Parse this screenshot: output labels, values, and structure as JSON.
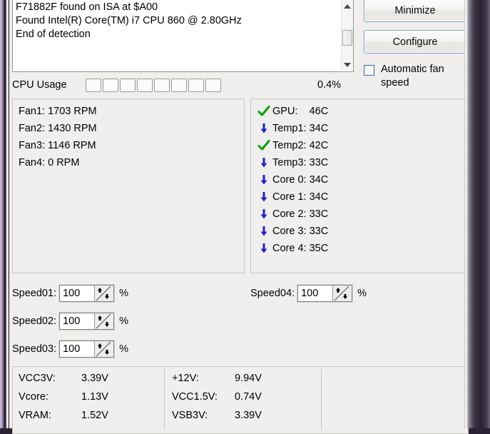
{
  "log": {
    "lines": "F71882F found on ISA at $A00\nFound Intel(R) Core(TM) i7 CPU 860 @ 2.80GHz\nEnd of detection"
  },
  "scrollbar": {
    "up_icon": "scroll-up-arrow",
    "down_icon": "scroll-down-arrow"
  },
  "buttons": {
    "minimize": "Minimize",
    "configure": "Configure"
  },
  "auto_fan": {
    "label": "Automatic fan speed",
    "checked": false
  },
  "cpu_usage": {
    "label": "CPU Usage",
    "percent": "0.4%",
    "blocks_total": 8,
    "blocks_filled": 0
  },
  "fans": [
    {
      "label": "Fan1:",
      "value": "1703 RPM"
    },
    {
      "label": "Fan2:",
      "value": "1430 RPM"
    },
    {
      "label": "Fan3:",
      "value": "1146 RPM"
    },
    {
      "label": "Fan4:",
      "value": "0 RPM"
    }
  ],
  "temps": [
    {
      "icon": "green-check-icon",
      "name": "GPU:",
      "value": "46C"
    },
    {
      "icon": "blue-down-arrow-icon",
      "name": "Temp1:",
      "value": "34C"
    },
    {
      "icon": "green-check-icon",
      "name": "Temp2:",
      "value": "42C"
    },
    {
      "icon": "blue-down-arrow-icon",
      "name": "Temp3:",
      "value": "33C"
    },
    {
      "icon": "blue-down-arrow-icon",
      "name": "Core 0:",
      "value": "34C"
    },
    {
      "icon": "blue-down-arrow-icon",
      "name": "Core 1:",
      "value": "34C"
    },
    {
      "icon": "blue-down-arrow-icon",
      "name": "Core 2:",
      "value": "33C"
    },
    {
      "icon": "blue-down-arrow-icon",
      "name": "Core 3:",
      "value": "33C"
    },
    {
      "icon": "blue-down-arrow-icon",
      "name": "Core 4:",
      "value": "35C"
    }
  ],
  "speeds": [
    {
      "label": "Speed01:",
      "value": "100",
      "unit": "%"
    },
    {
      "label": "Speed02:",
      "value": "100",
      "unit": "%"
    },
    {
      "label": "Speed03:",
      "value": "100",
      "unit": "%"
    },
    {
      "label": "Speed04:",
      "value": "100",
      "unit": "%"
    }
  ],
  "voltages": {
    "columns": [
      [
        {
          "name": "VCC3V:",
          "value": "3.39V"
        },
        {
          "name": "Vcore:",
          "value": "1.13V"
        },
        {
          "name": "VRAM:",
          "value": "1.52V"
        }
      ],
      [
        {
          "name": "+12V:",
          "value": "9.94V"
        },
        {
          "name": "VCC1.5V:",
          "value": "0.74V"
        },
        {
          "name": "VSB3V:",
          "value": "3.39V"
        }
      ],
      []
    ]
  },
  "colors": {
    "ok_green": "#00a000",
    "down_blue": "#2222cc",
    "panel_bg": "#f0efed",
    "button_border": "#7ca0c6"
  }
}
